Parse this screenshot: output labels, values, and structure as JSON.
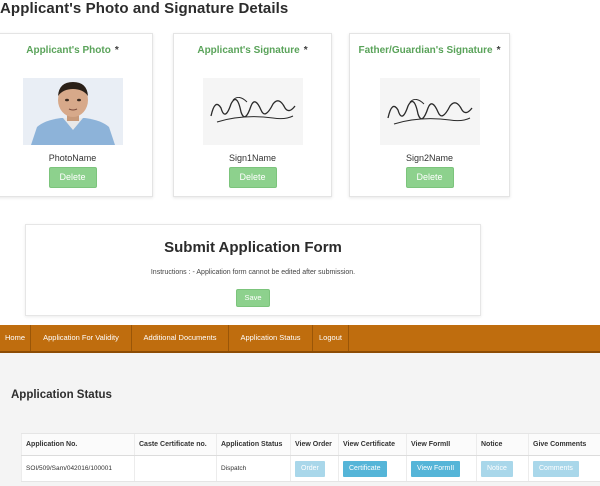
{
  "page": {
    "section_title": "Applicant's Photo and Signature Details"
  },
  "cards": [
    {
      "title": "Applicant's Photo",
      "required_mark": "*",
      "file_name": "PhotoName",
      "delete_label": "Delete"
    },
    {
      "title": "Applicant's Signature",
      "required_mark": "*",
      "file_name": "Sign1Name",
      "delete_label": "Delete"
    },
    {
      "title": "Father/Guardian's Signature",
      "required_mark": "*",
      "file_name": "Sign2Name",
      "delete_label": "Delete"
    }
  ],
  "submit": {
    "title": "Submit Application Form",
    "instructions": "Instructions : - Application form cannot be edited after submission.",
    "save_label": "Save"
  },
  "nav": {
    "items": [
      "Home",
      "Application For Validity",
      "Additional Documents",
      "Application Status",
      "Logout"
    ],
    "bg_color": "#bf6d0e"
  },
  "status": {
    "title": "Application Status",
    "columns": [
      "Application No.",
      "Caste Certificate no.",
      "Application Status",
      "View Order",
      "View Certificate",
      "View FormII",
      "Notice",
      "Give Comments"
    ],
    "rows": [
      {
        "application_no": "SOI/509/Sam/042016/100001",
        "caste_certificate_no": "",
        "application_status": "Dispatch",
        "order_label": "Order",
        "certificate_label": "Certificate",
        "formii_label": "View FormII",
        "notice_label": "Notice",
        "comments_label": "Comments"
      }
    ]
  },
  "colors": {
    "accent_green": "#5aa35a",
    "button_green": "#8dd18d",
    "button_blue": "#55b5d8"
  },
  "icons": {
    "photo": "applicant-photo-image",
    "signature": "signature-image"
  }
}
